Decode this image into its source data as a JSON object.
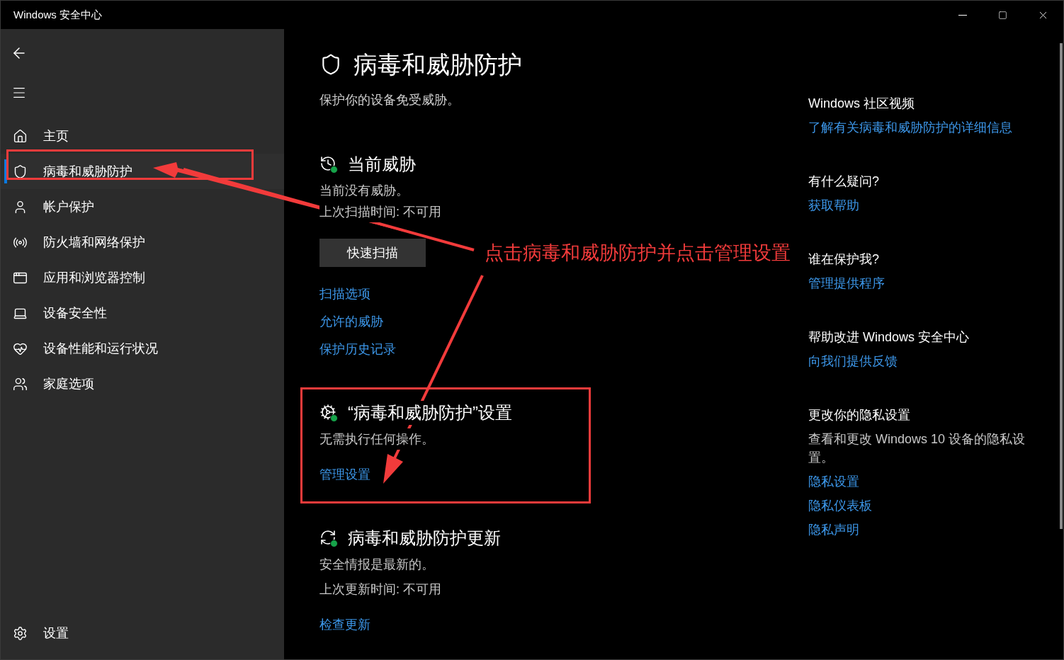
{
  "window": {
    "title": "Windows 安全中心"
  },
  "sidebar": {
    "items": [
      {
        "kind": "home",
        "label": "主页",
        "selected": false
      },
      {
        "kind": "shield",
        "label": "病毒和威胁防护",
        "selected": true
      },
      {
        "kind": "account",
        "label": "帐户保护",
        "selected": false
      },
      {
        "kind": "network",
        "label": "防火墙和网络保护",
        "selected": false
      },
      {
        "kind": "browser",
        "label": "应用和浏览器控制",
        "selected": false
      },
      {
        "kind": "device",
        "label": "设备安全性",
        "selected": false
      },
      {
        "kind": "health",
        "label": "设备性能和运行状况",
        "selected": false
      },
      {
        "kind": "family",
        "label": "家庭选项",
        "selected": false
      }
    ],
    "settings": {
      "label": "设置"
    }
  },
  "page": {
    "title": "病毒和威胁防护",
    "subtitle": "保护你的设备免受威胁。"
  },
  "sections": [
    {
      "kind": "threats",
      "title": "当前威胁",
      "lines": [
        "当前没有威胁。",
        "上次扫描时间: 不可用"
      ],
      "button": "快速扫描",
      "links": [
        "扫描选项",
        "允许的威胁",
        "保护历史记录"
      ]
    },
    {
      "kind": "settings",
      "title": "“病毒和威胁防护”设置",
      "lines": [
        "无需执行任何操作。"
      ],
      "links": [
        "管理设置"
      ]
    },
    {
      "kind": "updates",
      "title": "病毒和威胁防护更新",
      "lines": [
        "安全情报是最新的。",
        "上次更新时间: 不可用"
      ],
      "links": [
        "检查更新"
      ]
    }
  ],
  "side_panel": [
    {
      "heading": "Windows 社区视频",
      "links": [
        "了解有关病毒和威胁防护的详细信息"
      ]
    },
    {
      "heading": "有什么疑问?",
      "links": [
        "获取帮助"
      ]
    },
    {
      "heading": "谁在保护我?",
      "links": [
        "管理提供程序"
      ]
    },
    {
      "heading": "帮助改进 Windows 安全中心",
      "links": [
        "向我们提供反馈"
      ]
    },
    {
      "heading": "更改你的隐私设置",
      "text": "查看和更改 Windows 10 设备的隐私设置。",
      "links": [
        "隐私设置",
        "隐私仪表板",
        "隐私声明"
      ]
    }
  ],
  "annotation": {
    "callout": "点击病毒和威胁防护并点击管理设置"
  }
}
